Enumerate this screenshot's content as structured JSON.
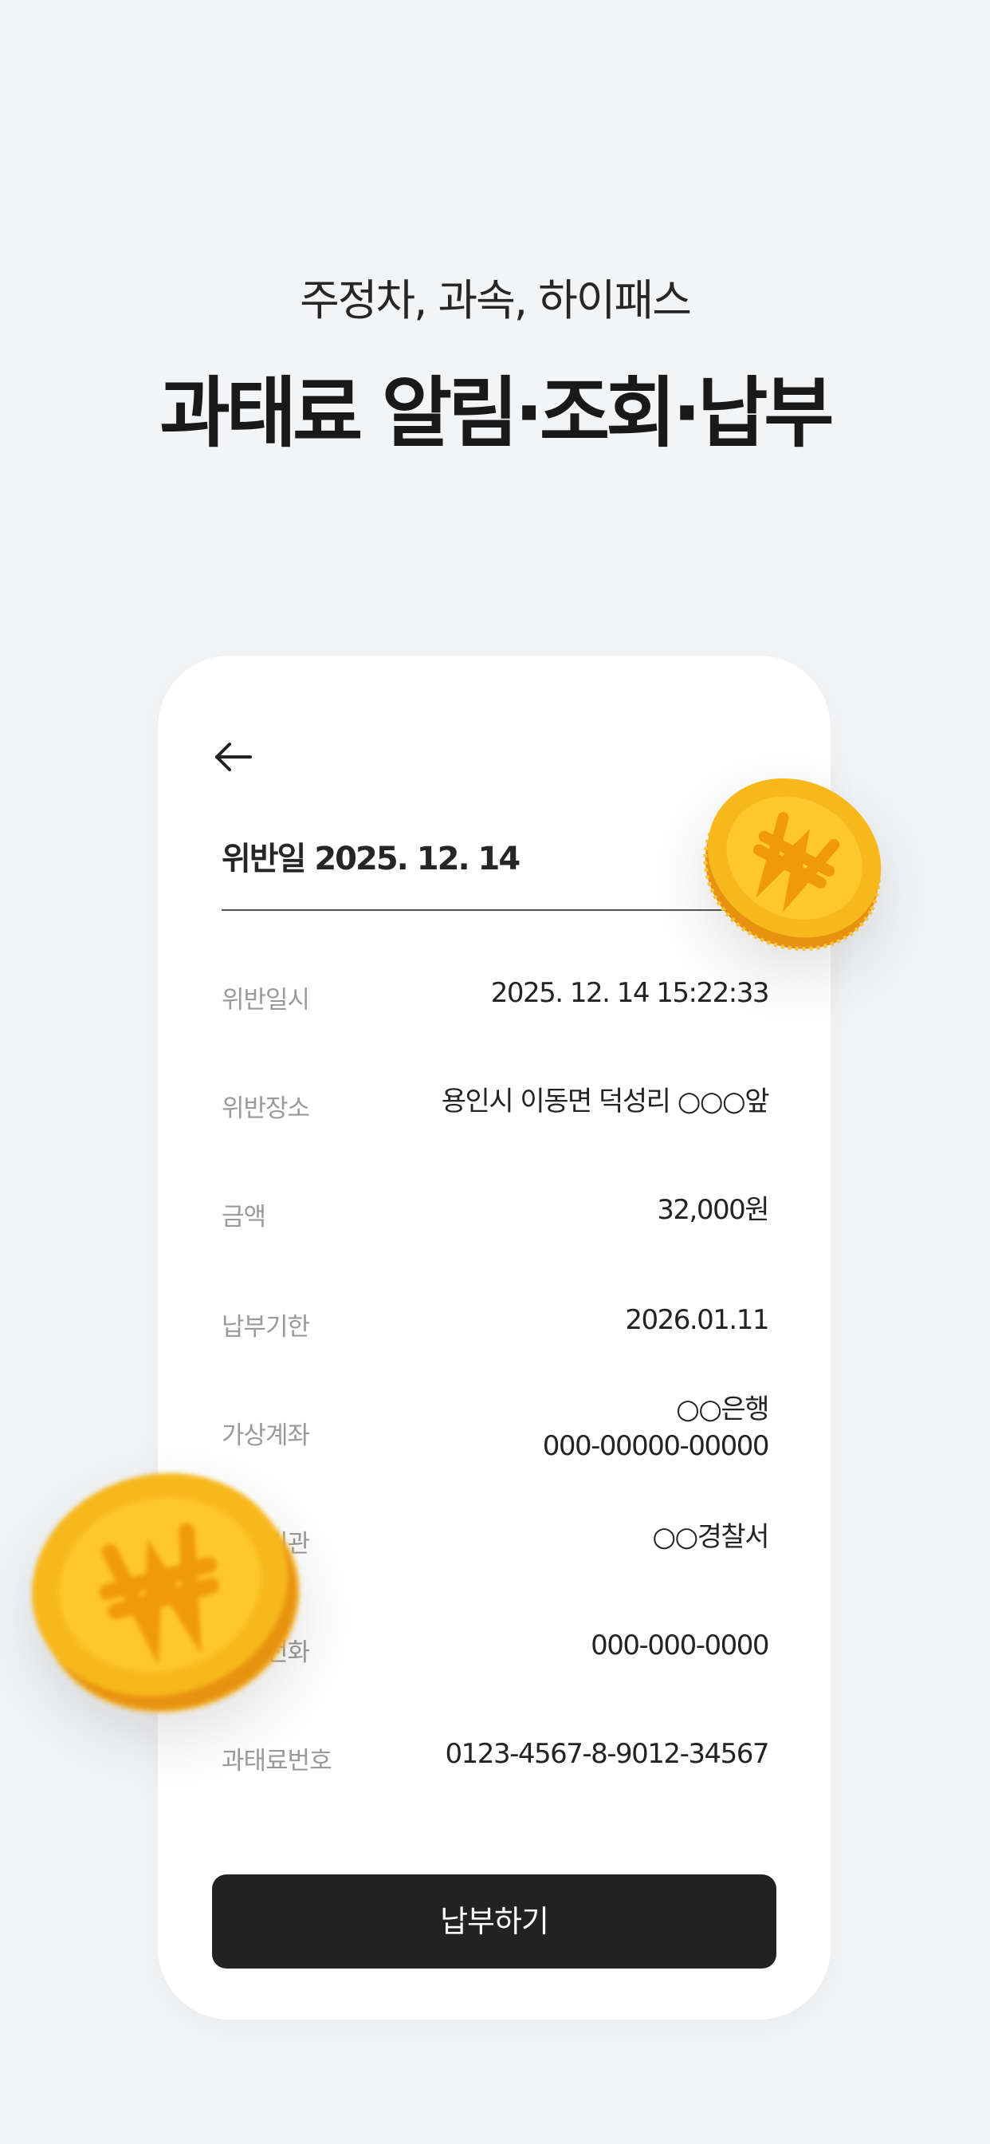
{
  "hero": {
    "subtitle": "주정차, 과속, 하이패스",
    "title": "과태료 알림·조회·납부"
  },
  "card": {
    "heading": "위반일 2025. 12. 14",
    "rows": [
      {
        "label": "위반일시",
        "value": "2025. 12. 14 15:22:33"
      },
      {
        "label": "위반장소",
        "value": "용인시 이동면 덕성리  ○○○앞"
      },
      {
        "label": "금액",
        "value": "32,000원"
      },
      {
        "label": "납부기한",
        "value": "2026.01.11"
      },
      {
        "label": "가상계좌",
        "value_line1": "○○은행",
        "value_line2": "000-00000-00000"
      },
      {
        "label": "부과기관",
        "value": "○○경찰서"
      },
      {
        "label": "기관전화",
        "value": "000-000-0000"
      },
      {
        "label": "과태료번호",
        "value": "0123-4567-8-9012-34567"
      }
    ],
    "pay_label": "납부하기"
  },
  "icons": {
    "back": "arrow-left-icon",
    "coin": "won-coin-icon"
  },
  "colors": {
    "background": "#f3f4f6",
    "card": "#ffffff",
    "button": "#222222",
    "coin": "#f7b81c"
  }
}
